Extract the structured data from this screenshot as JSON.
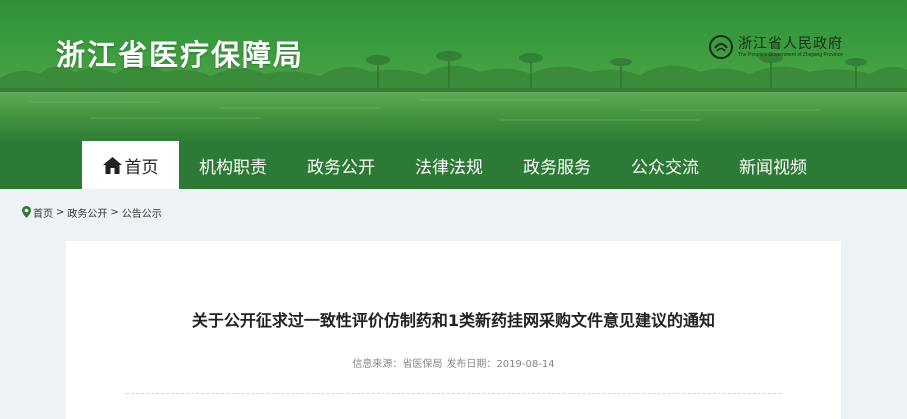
{
  "header": {
    "site_title": "浙江省医疗保障局",
    "gov_logo": {
      "name": "浙江省人民政府",
      "subtitle": "The People's Government of Zhejiang Province",
      "icon": "emblem-icon"
    }
  },
  "nav": {
    "items": [
      {
        "label": "首页",
        "icon": "home-icon",
        "active": true
      },
      {
        "label": "机构职责"
      },
      {
        "label": "政务公开"
      },
      {
        "label": "法律法规"
      },
      {
        "label": "政务服务"
      },
      {
        "label": "公众交流"
      },
      {
        "label": "新闻视频"
      }
    ]
  },
  "breadcrumb": {
    "icon": "location-pin-icon",
    "items": [
      "首页",
      "政务公开",
      "公告公示"
    ],
    "separator": ">"
  },
  "article": {
    "title": "关于公开征求过一致性评价仿制药和1类新药挂网采购文件意见建议的通知",
    "source_label": "信息来源：",
    "source": "省医保局",
    "date_label": "发布日期：",
    "date": "2019-08-14"
  },
  "colors": {
    "banner_green": "#3b9d3f",
    "nav_green": "#2c7a35",
    "page_background": "#eef2f5",
    "card_background": "#ffffff",
    "active_nav_background": "#ffffff"
  }
}
